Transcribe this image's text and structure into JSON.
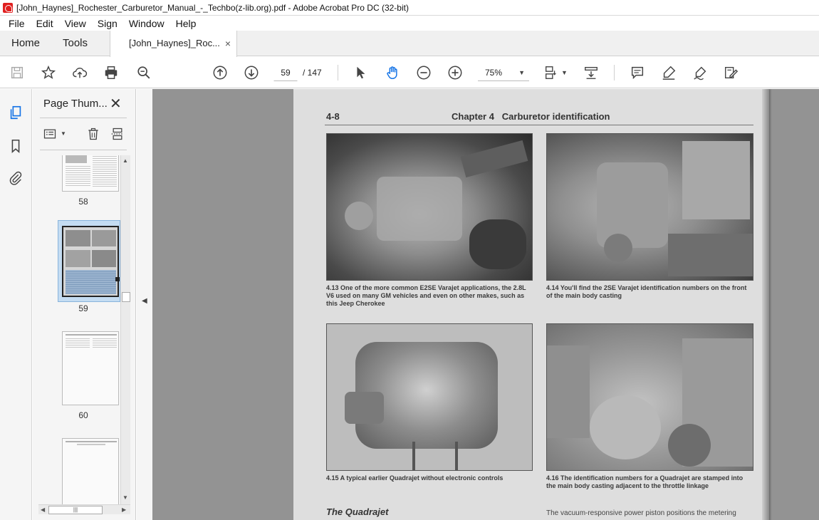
{
  "window": {
    "title": "[John_Haynes]_Rochester_Carburetor_Manual_-_Techbo(z-lib.org).pdf - Adobe Acrobat Pro DC (32-bit)"
  },
  "menu": [
    "File",
    "Edit",
    "View",
    "Sign",
    "Window",
    "Help"
  ],
  "tabs": {
    "home": "Home",
    "tools": "Tools",
    "document": "[John_Haynes]_Roc...",
    "close": "×"
  },
  "toolbar": {
    "page_current": "59",
    "page_total": "/ 147",
    "zoom": "75%"
  },
  "panel": {
    "title": "Page Thum...",
    "close": "✕",
    "thumbnails": [
      {
        "label": "58"
      },
      {
        "label": "59",
        "selected": true
      },
      {
        "label": "60"
      }
    ]
  },
  "page": {
    "header_left": "4-8",
    "header_right": "Chapter 4   Carburetor identification",
    "captions": [
      [
        "4.13  One of the more common E2SE Varajet applications, the 2.8L",
        "V6 used on many GM vehicles and even on other makes, such as",
        "this Jeep Cherokee"
      ],
      [
        "4.14  You'll find the 2SE Varajet identification numbers on the front",
        "of the main body casting"
      ],
      [
        "4.15  A typical earlier Quadrajet without electronic controls"
      ],
      [
        "4.16  The identification numbers for a Quadrajet are stamped into",
        "the main body casting adjacent to the throttle linkage"
      ]
    ],
    "section_title": "The Quadrajet",
    "body_start": "The vacuum-responsive power piston positions the metering"
  },
  "colors": {
    "doc_background": "#939393",
    "page": "#dedede",
    "selection": "#c4dcf2",
    "accent_blue": "#1473e6",
    "app_red": "#e02020"
  }
}
